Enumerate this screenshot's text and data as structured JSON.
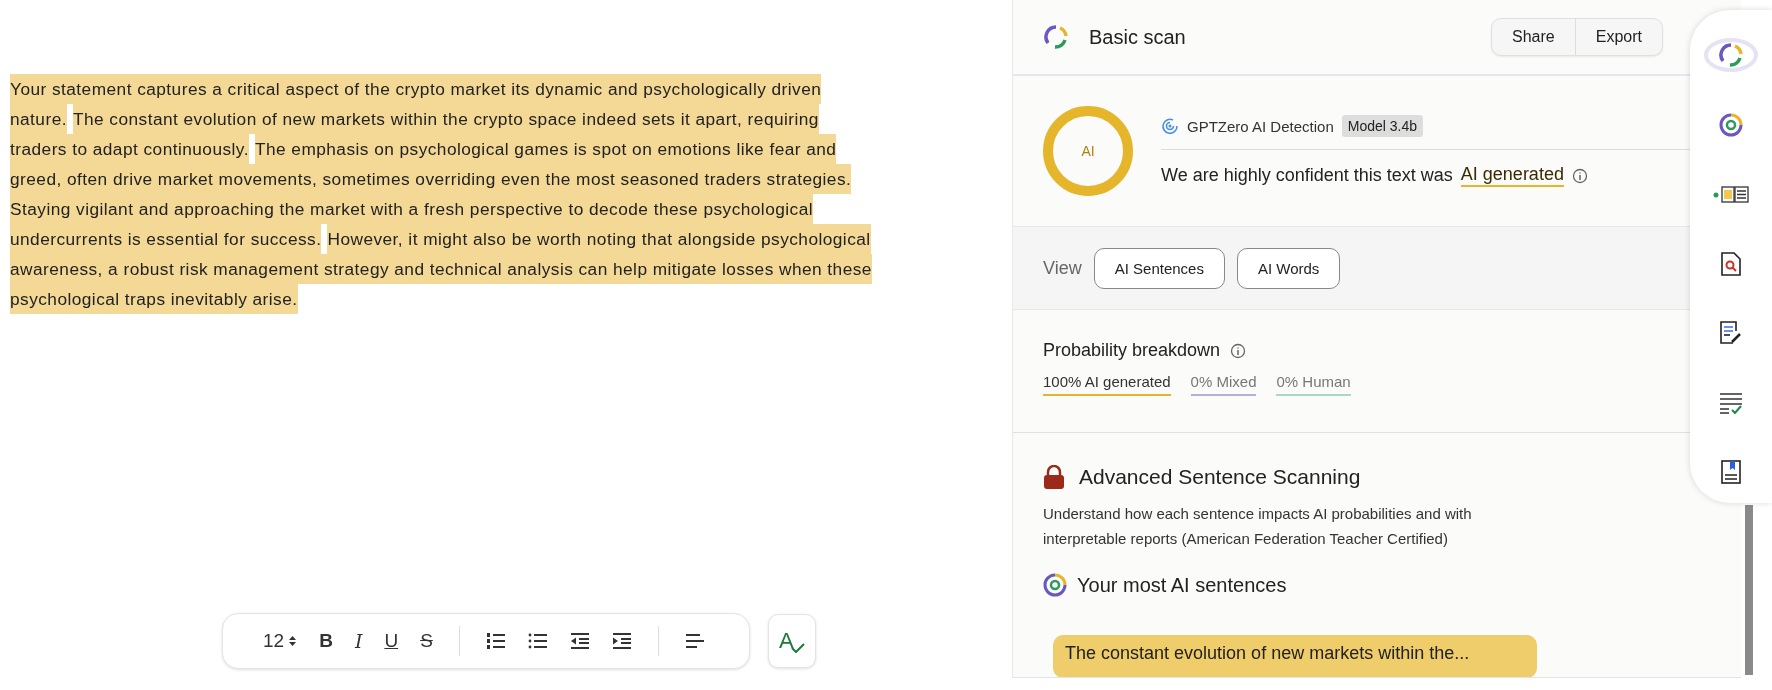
{
  "editor": {
    "lines": [
      {
        "segments": [
          {
            "text": "Your statement captures a critical aspect of the crypto market its dynamic and psychologically driven",
            "highlighted": true
          }
        ]
      },
      {
        "segments": [
          {
            "text": "nature.",
            "highlighted": true
          },
          {
            "text": "The constant evolution of new markets within the crypto space indeed sets it apart, requiring",
            "highlighted": true
          }
        ]
      },
      {
        "segments": [
          {
            "text": "traders to adapt continuously.",
            "highlighted": true
          },
          {
            "text": "The emphasis on psychological games is spot on emotions like fear and",
            "highlighted": true
          }
        ]
      },
      {
        "segments": [
          {
            "text": "greed, often drive market movements, sometimes overriding even the most seasoned traders strategies.",
            "highlighted": true
          }
        ]
      },
      {
        "segments": [
          {
            "text": "Staying vigilant and approaching the market with a fresh perspective to decode these psychological",
            "highlighted": true
          }
        ]
      },
      {
        "segments": [
          {
            "text": "undercurrents is essential for success.",
            "highlighted": true
          },
          {
            "text": "However, it might also be worth noting that alongside psychological",
            "highlighted": true
          }
        ]
      },
      {
        "segments": [
          {
            "text": "awareness, a robust risk management strategy and technical analysis can help mitigate losses when these",
            "highlighted": true
          }
        ]
      },
      {
        "segments": [
          {
            "text": "psychological traps inevitably arise.",
            "highlighted": true
          }
        ]
      }
    ]
  },
  "toolbar": {
    "font_size": "12",
    "format_buttons": [
      {
        "label": "B",
        "kind": "bold"
      },
      {
        "label": "I",
        "kind": "italic"
      },
      {
        "label": "U",
        "kind": "underline"
      },
      {
        "label": "S",
        "kind": "strike"
      }
    ],
    "spellcheck_label": "A"
  },
  "panel": {
    "title": "Basic scan",
    "actions": [
      "Share",
      "Export"
    ],
    "result": {
      "ring_label": "AI",
      "detector": "GPTZero AI Detection",
      "model": "Model 3.4b",
      "verdict_prefix": "We are highly confident this text was",
      "verdict": "AI generated"
    },
    "view": {
      "label": "View",
      "options": [
        "AI Sentences",
        "AI Words"
      ]
    },
    "breakdown": {
      "title": "Probability breakdown",
      "items": [
        {
          "label": "100% AI generated",
          "color": "#e5b52c"
        },
        {
          "label": "0% Mixed",
          "color": "#b7aee0"
        },
        {
          "label": "0% Human",
          "color": "#a9d7c4"
        }
      ]
    },
    "advanced": {
      "title": "Advanced Sentence Scanning",
      "description": "Understand how each sentence impacts AI probabilities and with interpretable reports (American Federation Teacher Certified)"
    },
    "top_sentences": {
      "title": "Your most AI sentences",
      "items": [
        "The constant evolution of new markets within the..."
      ]
    }
  },
  "sidebar": {
    "items": [
      {
        "kind": "logo",
        "selected": true
      },
      {
        "kind": "scan",
        "selected": false
      },
      {
        "kind": "doc-a",
        "selected": false
      },
      {
        "kind": "doc-search",
        "selected": false
      },
      {
        "kind": "doc-edit",
        "selected": false
      },
      {
        "kind": "list-check",
        "selected": false
      },
      {
        "kind": "bookmark",
        "selected": false
      }
    ]
  }
}
